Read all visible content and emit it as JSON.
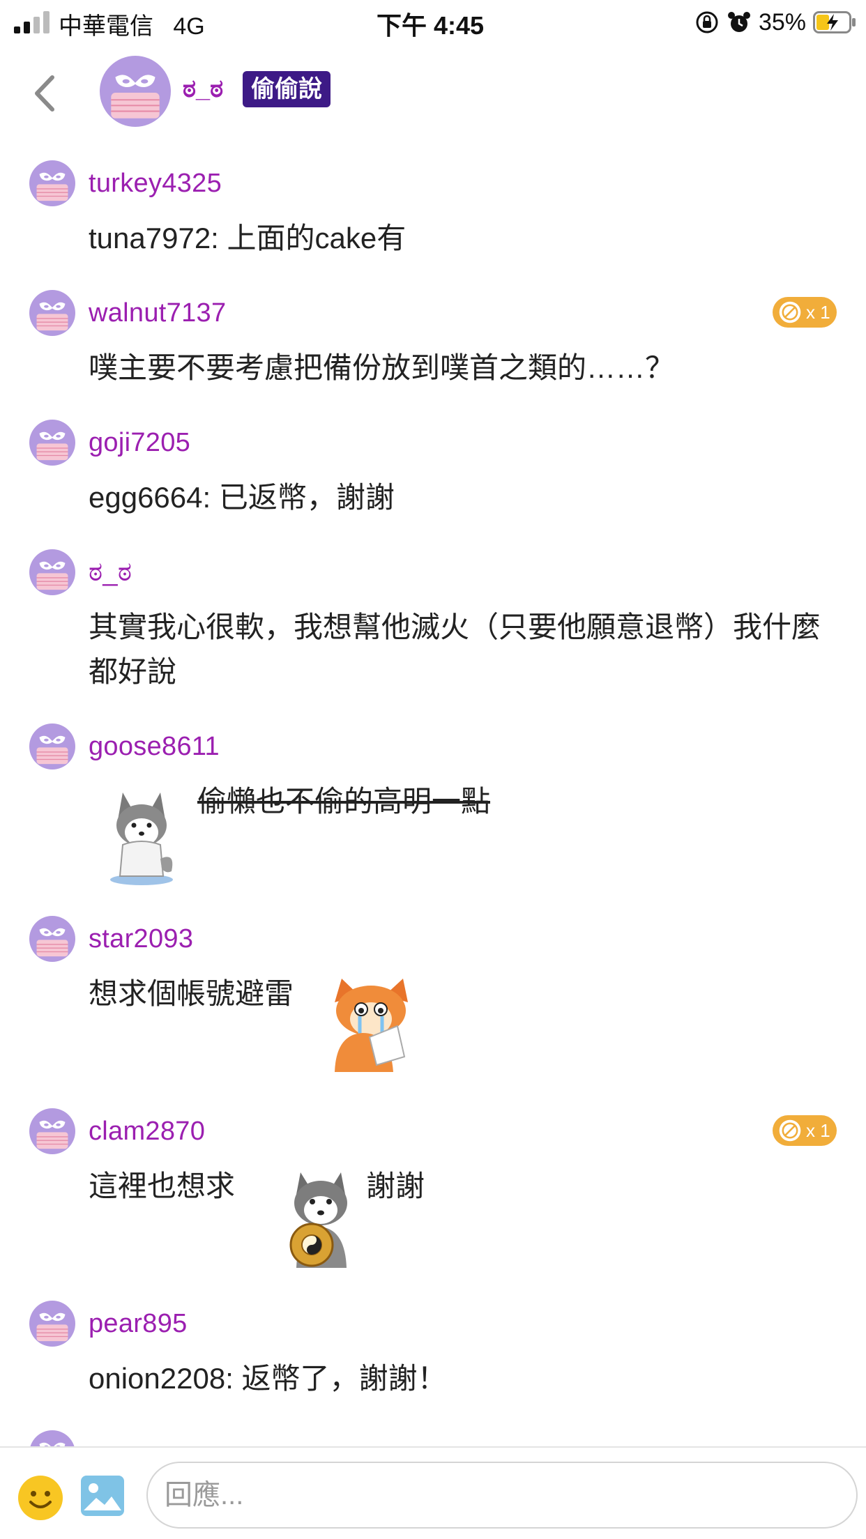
{
  "status_bar": {
    "carrier": "中華電信",
    "network": "4G",
    "time": "下午 4:45",
    "battery_percent": "35%",
    "icons": [
      "signal-icon",
      "rotation-lock-icon",
      "alarm-icon",
      "battery-charging-icon"
    ]
  },
  "header": {
    "back_icon": "chevron-left-icon",
    "author": "ಠ_ಠ",
    "badge": "偷偷說"
  },
  "responses": [
    {
      "user": "turkey4325",
      "text": "tuna7972: 上面的cake有"
    },
    {
      "user": "walnut7137",
      "text": "噗主要不要考慮把備份放到噗首之類的……？",
      "coin": "x 1"
    },
    {
      "user": "goji7205",
      "text": "egg6664: 已返幣，謝謝"
    },
    {
      "user": "ಠ_ಠ",
      "text": "其實我心很軟，我想幫他滅火（只要他願意退幣）我什麼都好說"
    },
    {
      "user": "goose8611",
      "text": "偷懶也不偷的高明一點",
      "sticker": "husky-sitting-sticker"
    },
    {
      "user": "star2093",
      "text": "想求個帳號避雷",
      "sticker": "crying-fox-sticker"
    },
    {
      "user": "clam2870",
      "text_before": "這裡也想求",
      "text_after": "謝謝",
      "coin": "x 1",
      "sticker": "husky-with-coin-sticker"
    },
    {
      "user": "pear895",
      "text": "onion2208: 返幣了，謝謝！"
    }
  ],
  "reply_bar": {
    "placeholder": "回應...",
    "emoji_icon": "smiley-icon",
    "image_icon": "image-icon"
  },
  "colors": {
    "username": "#9b1fb0",
    "badge_bg": "#3d1a86",
    "coin_bg": "#f1ad3a",
    "avatar_purple": "#b39ae0",
    "avatar_pink": "#f6c6d4"
  }
}
